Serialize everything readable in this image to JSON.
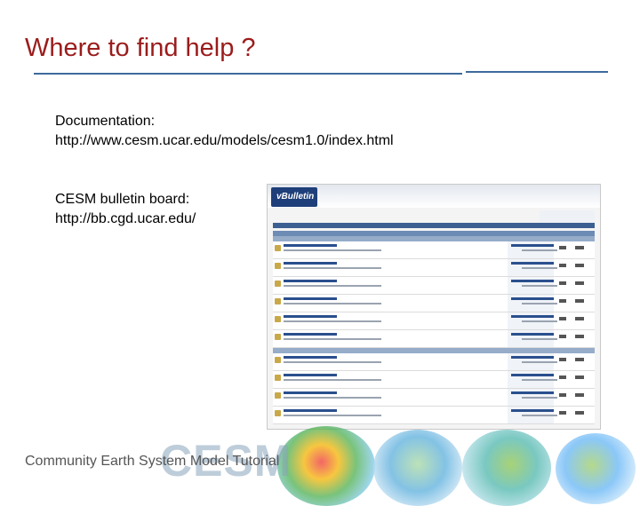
{
  "slide": {
    "title": "Where to find help ?",
    "documentation_label": "Documentation:",
    "documentation_url": "http://www.cesm.ucar.edu/models/cesm1.0/index.html",
    "bulletin_label": "CESM bulletin board:",
    "bulletin_url": "http://bb.cgd.ucar.edu/"
  },
  "forum_screenshot": {
    "logo_text": "vBulletin",
    "rows": 10
  },
  "footer": {
    "text": "Community Earth System Model Tutorial",
    "logo": "CESM"
  },
  "colors": {
    "title": "#9b1c1c",
    "rule": "#3d6a9c",
    "forum_nav": "#3c5f92"
  }
}
